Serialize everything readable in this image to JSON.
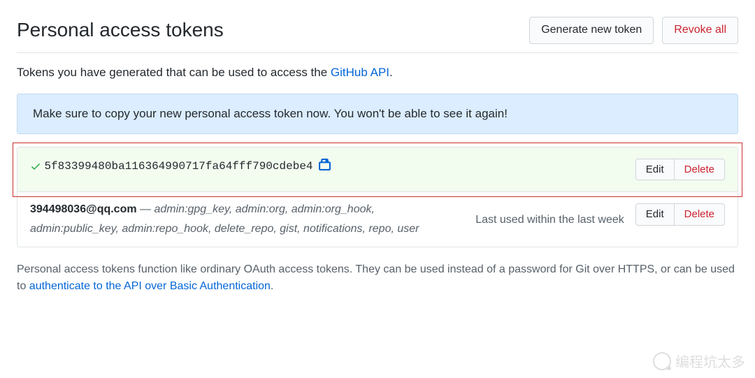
{
  "header": {
    "title": "Personal access tokens",
    "generate_label": "Generate new token",
    "revoke_label": "Revoke all"
  },
  "intro": {
    "prefix": "Tokens you have generated that can be used to access the ",
    "link": "GitHub API",
    "suffix": "."
  },
  "flash": "Make sure to copy your new personal access token now. You won't be able to see it again!",
  "tokens": {
    "new_token": {
      "value": "5f83399480ba116364990717fa64fff790cdebe4",
      "edit_label": "Edit",
      "delete_label": "Delete"
    },
    "existing_token": {
      "name": "394498036@qq.com",
      "scopes_line1": "admin:gpg_key, admin:org, admin:org_hook,",
      "scopes_line2": "admin:public_key, admin:repo_hook, delete_repo, gist, notifications, repo, user",
      "last_used": "Last used within the last week",
      "edit_label": "Edit",
      "delete_label": "Delete"
    }
  },
  "footer": {
    "prefix": "Personal access tokens function like ordinary OAuth access tokens. They can be used instead of a password for Git over HTTPS, or can be used to ",
    "link": "authenticate to the API over Basic Authentication",
    "suffix": "."
  },
  "watermark": "编程坑太多"
}
